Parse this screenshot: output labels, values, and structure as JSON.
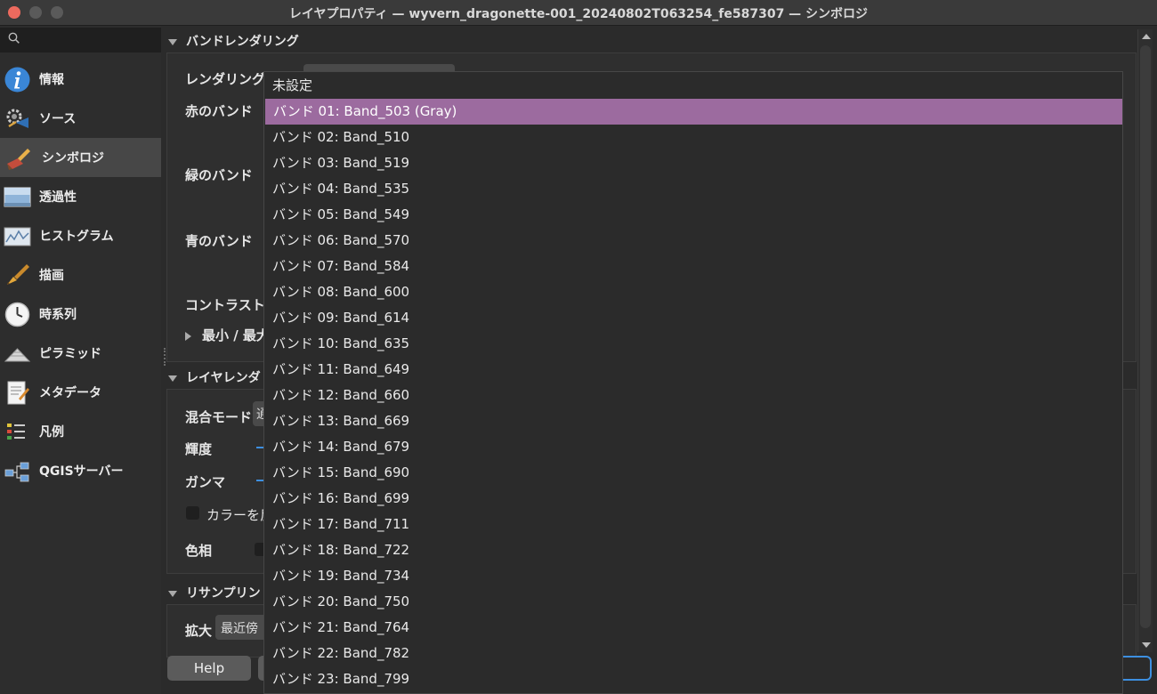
{
  "window": {
    "title": "レイヤプロパティ — wyvern_dragonette-001_20240802T063254_fe587307 — シンボロジ"
  },
  "sidebar": {
    "search_placeholder": "",
    "items": [
      {
        "label": "情報",
        "icon": "info-icon"
      },
      {
        "label": "ソース",
        "icon": "source-icon"
      },
      {
        "label": "シンボロジ",
        "icon": "symbology-icon",
        "selected": true
      },
      {
        "label": "透過性",
        "icon": "transparency-icon"
      },
      {
        "label": "ヒストグラム",
        "icon": "histogram-icon"
      },
      {
        "label": "描画",
        "icon": "rendering-icon"
      },
      {
        "label": "時系列",
        "icon": "temporal-icon"
      },
      {
        "label": "ピラミッド",
        "icon": "pyramids-icon"
      },
      {
        "label": "メタデータ",
        "icon": "metadata-icon"
      },
      {
        "label": "凡例",
        "icon": "legend-icon"
      },
      {
        "label": "QGISサーバー",
        "icon": "qgis-server-icon"
      }
    ]
  },
  "band_rendering": {
    "header": "バンドレンダリング",
    "render_type_label": "レンダリングタ",
    "red_band_label": "赤のバンド",
    "green_band_label": "緑のバンド",
    "blue_band_label": "青のバンド",
    "contrast_label": "コントラスト",
    "minmax_label": "最小 / 最大"
  },
  "layer_rendering": {
    "header": "レイヤレンダ",
    "blend_mode_label": "混合モード",
    "blend_mode_value": "通",
    "brightness_label": "輝度",
    "gamma_label": "ガンマ",
    "invert_label": "カラーを反",
    "hue_label": "色相"
  },
  "resampling": {
    "header": "リサンプリン",
    "zoom_in_label": "拡大",
    "zoom_in_value": "最近傍"
  },
  "buttons": {
    "help": "Help"
  },
  "dropdown": {
    "selected_index": 1,
    "options": [
      "未設定",
      "バンド 01: Band_503 (Gray)",
      "バンド 02: Band_510",
      "バンド 03: Band_519",
      "バンド 04: Band_535",
      "バンド 05: Band_549",
      "バンド 06: Band_570",
      "バンド 07: Band_584",
      "バンド 08: Band_600",
      "バンド 09: Band_614",
      "バンド 10: Band_635",
      "バンド 11: Band_649",
      "バンド 12: Band_660",
      "バンド 13: Band_669",
      "バンド 14: Band_679",
      "バンド 15: Band_690",
      "バンド 16: Band_699",
      "バンド 17: Band_711",
      "バンド 18: Band_722",
      "バンド 19: Band_734",
      "バンド 20: Band_750",
      "バンド 21: Band_764",
      "バンド 22: Band_782",
      "バンド 23: Band_799"
    ]
  },
  "colors": {
    "selection": "#9c6b9f",
    "accent": "#3d8fe0",
    "close": "#ed6a5e"
  }
}
